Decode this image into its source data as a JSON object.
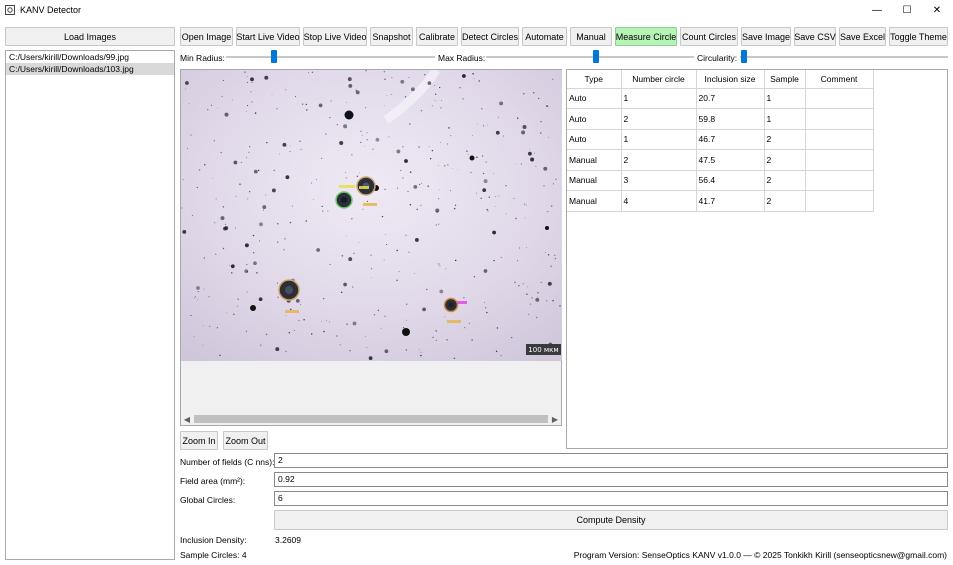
{
  "window": {
    "title": "KANV Detector",
    "minimize_glyph": "—",
    "maximize_glyph": "☐",
    "close_glyph": "✕"
  },
  "sidebar": {
    "load_images_label": "Load Images",
    "files": [
      "C:/Users/kirill/Downloads/99.jpg",
      "C:/Users/kirill/Downloads/103.jpg"
    ],
    "selected_index": 1
  },
  "toolbar": {
    "open_image": "Open Image",
    "start_live_video": "Start Live Video",
    "stop_live_video": "Stop Live Video",
    "snapshot": "Snapshot",
    "calibrate": "Calibrate",
    "detect_circles": "Detect Circles",
    "automate": "Automate",
    "manual": "Manual",
    "measure_circle": "Measure Circle",
    "count_circles": "Count Circles",
    "save_image": "Save Image",
    "save_csv": "Save CSV",
    "save_excel": "Save Excel",
    "toggle_theme": "Toggle Theme",
    "active_button": "measure_circle",
    "active_color": "#b6f3b6"
  },
  "sliders": {
    "min_radius_label": "Min Radius:",
    "max_radius_label": "Max Radius:",
    "circularity_label": "Circularity:",
    "min_radius_level": 0.18,
    "max_radius_level": 0.52,
    "circularity_level": 0.0,
    "thumb_color": "#0078d7"
  },
  "image": {
    "scale_bar_label": "100 мкм",
    "zoom_in_label": "Zoom In",
    "zoom_out_label": "Zoom Out",
    "left_arrow_icon": "chevron-left-icon",
    "right_arrow_icon": "chevron-right-icon"
  },
  "table": {
    "headers": [
      "Type",
      "Number circle",
      "Inclusion size",
      "Sample",
      "Comment"
    ],
    "rows": [
      [
        "Auto",
        "1",
        "20.7",
        "1",
        ""
      ],
      [
        "Auto",
        "2",
        "59.8",
        "1",
        ""
      ],
      [
        "Auto",
        "1",
        "46.7",
        "2",
        ""
      ],
      [
        "Manual",
        "2",
        "47.5",
        "2",
        ""
      ],
      [
        "Manual",
        "3",
        "56.4",
        "2",
        ""
      ],
      [
        "Manual",
        "4",
        "41.7",
        "2",
        ""
      ]
    ]
  },
  "form": {
    "number_of_fields_label": "Number of fields (C nns):",
    "number_of_fields_value": "2",
    "field_area_label": "Field area (mm²):",
    "field_area_value": "0.92",
    "global_circles_label": "Global Circles:",
    "global_circles_value": "6",
    "compute_density_label": "Compute Density"
  },
  "results": {
    "inclusion_density_label": "Inclusion Density:",
    "inclusion_density_value": "3.2609",
    "sample_circles_text": "Sample Circles: 4",
    "program_version_text": "Program Version: SenseOptics KANV v1.0.0 — © 2025 Tonkikh Kirill (senseopticsnew@gmail.com)"
  }
}
